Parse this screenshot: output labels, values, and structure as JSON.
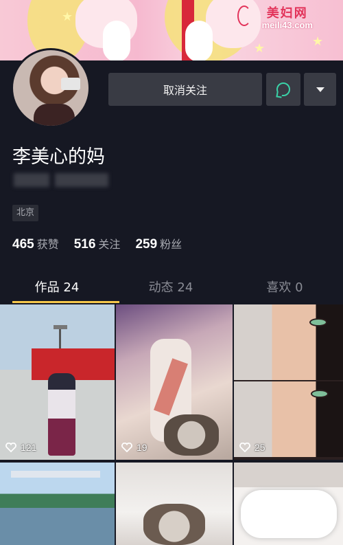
{
  "banner": {
    "watermark_title": "美妇网",
    "watermark_url": "meili43.com"
  },
  "profile": {
    "name": "李美心的妈",
    "location": "北京",
    "actions": {
      "unfollow_label": "取消关注",
      "message_icon": "chat-bubble-icon",
      "more_icon": "triangle-down-icon"
    },
    "stats": [
      {
        "value": "465",
        "label": "获赞"
      },
      {
        "value": "516",
        "label": "关注"
      },
      {
        "value": "259",
        "label": "粉丝"
      }
    ]
  },
  "tabs": [
    {
      "label": "作品 24",
      "active": true
    },
    {
      "label": "动态 24",
      "active": false
    },
    {
      "label": "喜欢 0",
      "active": false
    }
  ],
  "colors": {
    "background": "#161823",
    "button": "#393b44",
    "accent_underline": "#f6c84b",
    "message_icon": "#3ad3a8"
  },
  "videos": [
    {
      "likes": "121"
    },
    {
      "likes": "19"
    },
    {
      "likes": "25"
    },
    {
      "likes": ""
    },
    {
      "likes": ""
    },
    {
      "likes": ""
    }
  ]
}
